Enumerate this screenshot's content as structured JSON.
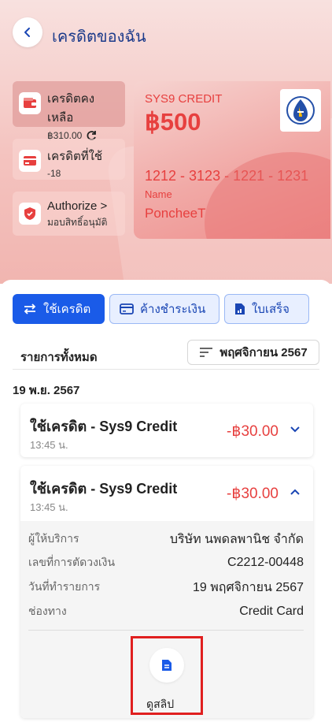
{
  "header": {
    "title": "เครดิตของฉัน"
  },
  "info_cards": [
    {
      "label": "เครดิตคงเหลือ",
      "sub": "฿310.00",
      "icon": "wallet-icon"
    },
    {
      "label": "เครดิตที่ใช้",
      "sub": "-18",
      "icon": "card-icon"
    },
    {
      "label": "Authorize >",
      "sub": "มอบสิทธิ์อนุมัติ",
      "icon": "shield-check-icon"
    }
  ],
  "credit_card": {
    "brand": "SYS9 CREDIT",
    "amount": "฿500",
    "number": "1212 - 3123 - 1221 - 1231",
    "name_label": "Name",
    "name": "PoncheeT"
  },
  "tabs": [
    {
      "label": "ใช้เครดิต",
      "active": true
    },
    {
      "label": "ค้างชำระเงิน",
      "active": false
    },
    {
      "label": "ใบเสร็จ",
      "active": false
    }
  ],
  "list": {
    "title": "รายการทั้งหมด",
    "filter": "พฤศจิกายน 2567",
    "date_group": "19 พ.ย. 2567"
  },
  "transactions": [
    {
      "title": "ใช้เครดิต - Sys9 Credit",
      "time": "13:45 น.",
      "amount": "-฿30.00"
    },
    {
      "title": "ใช้เครดิต - Sys9 Credit",
      "time": "13:45 น.",
      "amount": "-฿30.00"
    }
  ],
  "details": [
    {
      "label": "ผู้ให้บริการ",
      "value": "บริษัท นพดลพานิช จำกัด"
    },
    {
      "label": "เลขที่การตัดวงเงิน",
      "value": "C2212-00448"
    },
    {
      "label": "วันที่ทำรายการ",
      "value": "19 พฤศจิกายน 2567"
    },
    {
      "label": "ช่องทาง",
      "value": "Credit Card"
    }
  ],
  "slip": {
    "label": "ดูสลิป"
  },
  "colors": {
    "accent": "#1a5be8",
    "negative": "#e7403f",
    "highlight": "#e01f1f"
  }
}
